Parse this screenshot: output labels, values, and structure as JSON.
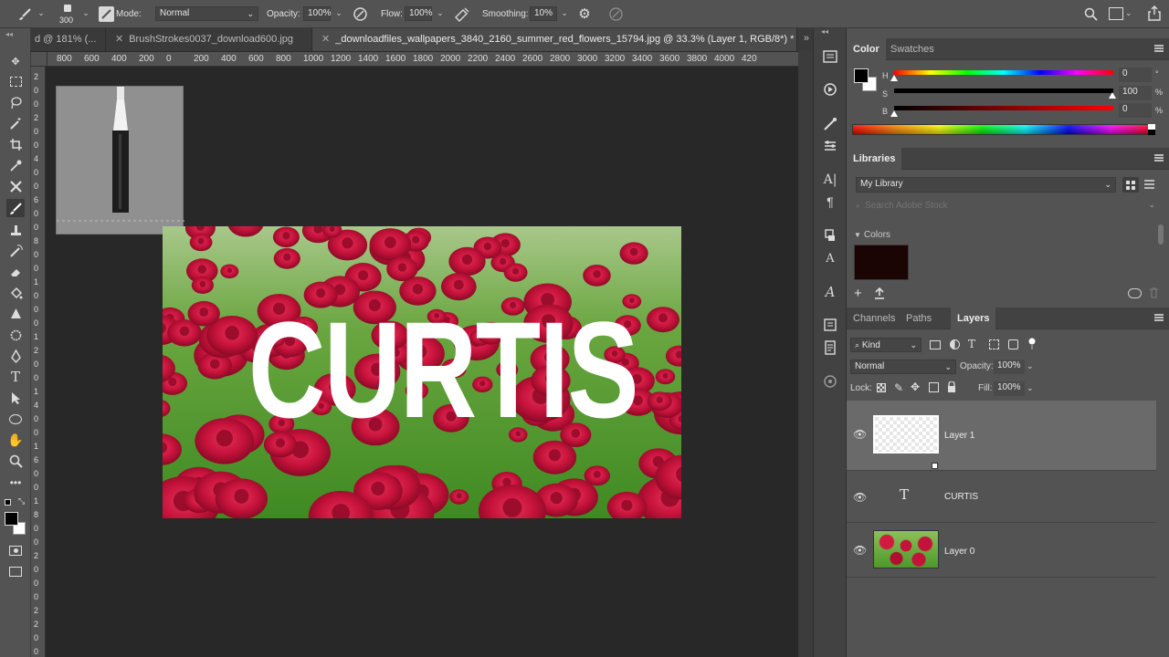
{
  "options": {
    "brush_size": "300",
    "mode_label": "Mode:",
    "mode_value": "Normal",
    "opacity_label": "Opacity:",
    "opacity_value": "100%",
    "flow_label": "Flow:",
    "flow_value": "100%",
    "smoothing_label": "Smoothing:",
    "smoothing_value": "10%"
  },
  "tabs": [
    {
      "label": "d @ 181% (..."
    },
    {
      "label": "BrushStrokes0037_download600.jpg"
    },
    {
      "label": "_downloadfiles_wallpapers_3840_2160_summer_red_flowers_15794.jpg @ 33.3% (Layer 1, RGB/8*) *"
    }
  ],
  "ruler_h": [
    "800",
    "600",
    "400",
    "200",
    "0",
    "200",
    "400",
    "600",
    "800",
    "1000",
    "1200",
    "1400",
    "1600",
    "1800",
    "2000",
    "2200",
    "2400",
    "2600",
    "2800",
    "3000",
    "3200",
    "3400",
    "3600",
    "3800",
    "4000",
    "420"
  ],
  "ruler_v": [
    "2",
    "0",
    "0",
    "2",
    "0",
    "0",
    "4",
    "0",
    "0",
    "6",
    "0",
    "0",
    "8",
    "0",
    "0",
    "1",
    "0",
    "0",
    "0",
    "1",
    "2",
    "0",
    "0",
    "1",
    "4",
    "0",
    "0",
    "1",
    "6",
    "0",
    "0",
    "1",
    "8",
    "0",
    "0",
    "2",
    "0",
    "0",
    "0",
    "2",
    "2",
    "0",
    "0"
  ],
  "canvas_text": "CURTIS",
  "color_panel": {
    "tabs": [
      "Color",
      "Swatches"
    ],
    "h_label": "H",
    "h_value": "0",
    "h_unit": "°",
    "s_label": "S",
    "s_value": "100",
    "s_unit": "%",
    "b_label": "B",
    "b_value": "0",
    "b_unit": "%"
  },
  "libraries": {
    "title": "Libraries",
    "library_name": "My Library",
    "search_placeholder": "Search Adobe Stock",
    "colors_label": "Colors",
    "swatch_color": "#1a0404"
  },
  "layers_panel": {
    "tabs": [
      "Channels",
      "Paths",
      "Layers"
    ],
    "kind_label": "Kind",
    "blend_mode": "Normal",
    "opacity_label": "Opacity:",
    "opacity_value": "100%",
    "lock_label": "Lock:",
    "fill_label": "Fill:",
    "fill_value": "100%",
    "layers": [
      {
        "name": "Layer 1"
      },
      {
        "name": "CURTIS"
      },
      {
        "name": "Layer 0"
      }
    ]
  },
  "colors": {
    "accent_text": "#ffffff",
    "flower_red": "#c4123a",
    "leaf_green": "#5ea83a"
  }
}
